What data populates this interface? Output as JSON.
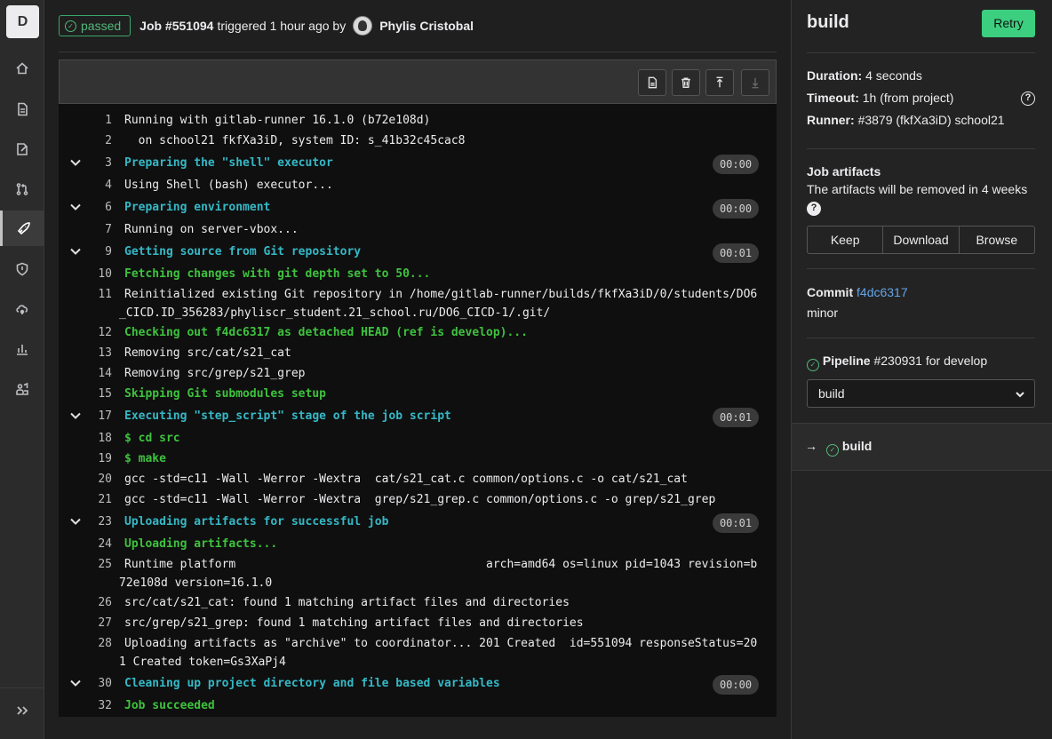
{
  "nav": {
    "project_initial": "D",
    "items": [
      "home-icon",
      "issues-icon",
      "snippets-icon",
      "merge-request-icon",
      "cicd-rocket-icon",
      "security-shield-icon",
      "deployments-icon",
      "analytics-icon",
      "members-icon"
    ],
    "active": "cicd-rocket-icon",
    "collapse_icon": "expand-sidebar-icon"
  },
  "header": {
    "status": "passed",
    "job_label": "Job #551094",
    "triggered_text": "triggered 1 hour ago by",
    "user_name": "Phylis Cristobal"
  },
  "toolbar": {
    "buttons": [
      "raw-log-icon",
      "erase-log-icon",
      "scroll-top-icon",
      "scroll-bottom-icon"
    ]
  },
  "log": [
    {
      "n": "1",
      "text": "Running with gitlab-runner 16.1.0 (b72e108d)",
      "kind": "plain"
    },
    {
      "n": "2",
      "text": "  on school21 fkfXa3iD, system ID: s_41b32c45cac8",
      "kind": "plain"
    },
    {
      "n": "3",
      "text": "Preparing the \"shell\" executor",
      "kind": "section",
      "dur": "00:00"
    },
    {
      "n": "4",
      "text": "Using Shell (bash) executor...",
      "kind": "plain"
    },
    {
      "n": "6",
      "text": "Preparing environment",
      "kind": "section",
      "dur": "00:00"
    },
    {
      "n": "7",
      "text": "Running on server-vbox...",
      "kind": "plain"
    },
    {
      "n": "9",
      "text": "Getting source from Git repository",
      "kind": "section",
      "dur": "00:01"
    },
    {
      "n": "10",
      "text": "Fetching changes with git depth set to 50...",
      "kind": "green"
    },
    {
      "n": "11",
      "text": "Reinitialized existing Git repository in /home/gitlab-runner/builds/fkfXa3iD/0/students/DO6",
      "text2": "_CICD.ID_356283/phyliscr_student.21_school.ru/DO6_CICD-1/.git/",
      "kind": "plain"
    },
    {
      "n": "12",
      "text": "Checking out f4dc6317 as detached HEAD (ref is develop)...",
      "kind": "green"
    },
    {
      "n": "13",
      "text": "Removing src/cat/s21_cat",
      "kind": "plain"
    },
    {
      "n": "14",
      "text": "Removing src/grep/s21_grep",
      "kind": "plain"
    },
    {
      "n": "15",
      "text": "Skipping Git submodules setup",
      "kind": "green"
    },
    {
      "n": "17",
      "text": "Executing \"step_script\" stage of the job script",
      "kind": "section",
      "dur": "00:01"
    },
    {
      "n": "18",
      "text": "$ cd src",
      "kind": "green"
    },
    {
      "n": "19",
      "text": "$ make",
      "kind": "green"
    },
    {
      "n": "20",
      "text": "gcc -std=c11 -Wall -Werror -Wextra  cat/s21_cat.c common/options.c -o cat/s21_cat",
      "kind": "plain"
    },
    {
      "n": "21",
      "text": "gcc -std=c11 -Wall -Werror -Wextra  grep/s21_grep.c common/options.c -o grep/s21_grep",
      "kind": "plain"
    },
    {
      "n": "23",
      "text": "Uploading artifacts for successful job",
      "kind": "section",
      "dur": "00:01"
    },
    {
      "n": "24",
      "text": "Uploading artifacts...",
      "kind": "green"
    },
    {
      "n": "25",
      "text": "Runtime platform                                    arch=amd64 os=linux pid=1043 revision=b",
      "text2": "72e108d version=16.1.0",
      "kind": "plain"
    },
    {
      "n": "26",
      "text": "src/cat/s21_cat: found 1 matching artifact files and directories",
      "kind": "plain"
    },
    {
      "n": "27",
      "text": "src/grep/s21_grep: found 1 matching artifact files and directories",
      "kind": "plain"
    },
    {
      "n": "28",
      "text": "Uploading artifacts as \"archive\" to coordinator... 201 Created  id=551094 responseStatus=20",
      "text2": "1 Created token=Gs3XaPj4",
      "kind": "plain"
    },
    {
      "n": "30",
      "text": "Cleaning up project directory and file based variables",
      "kind": "section",
      "dur": "00:00"
    },
    {
      "n": "32",
      "text": "Job succeeded",
      "kind": "green"
    }
  ],
  "sidebar": {
    "title": "build",
    "retry_label": "Retry",
    "duration_label": "Duration:",
    "duration_value": "4 seconds",
    "timeout_label": "Timeout:",
    "timeout_value": "1h (from project)",
    "runner_label": "Runner:",
    "runner_value": "#3879 (fkfXa3iD) school21",
    "artifacts_title": "Job artifacts",
    "artifacts_note": "The artifacts will be removed in 4 weeks",
    "artifact_buttons": [
      "Keep",
      "Download",
      "Browse"
    ],
    "commit_label": "Commit",
    "commit_sha": "f4dc6317",
    "commit_message": "minor",
    "pipeline_label": "Pipeline",
    "pipeline_text": "#230931 for develop",
    "stage_selected": "build",
    "current_job": "build",
    "arrow": "→"
  }
}
